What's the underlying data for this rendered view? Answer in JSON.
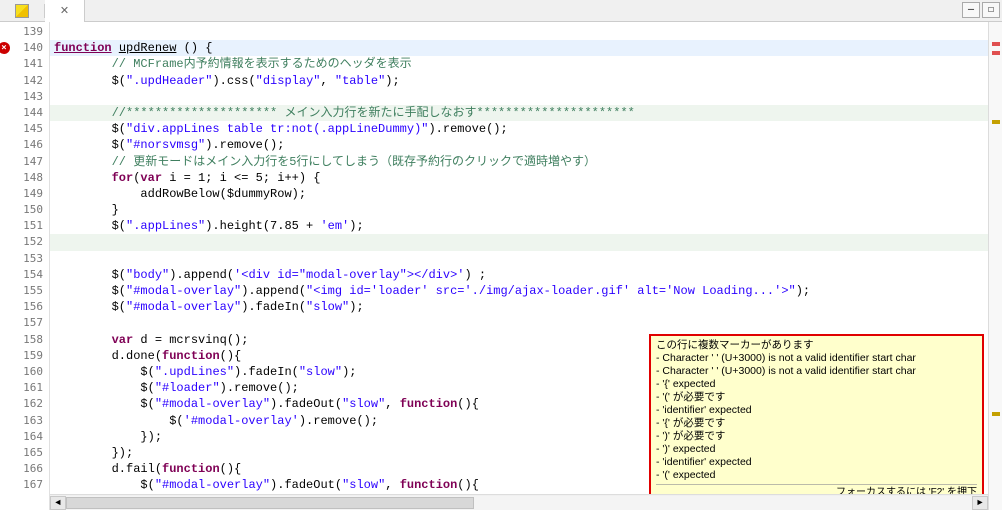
{
  "toolbar": {
    "close_glyph": "✕",
    "min_glyph": "—",
    "max_glyph": "☐"
  },
  "gutter": {
    "start": 139,
    "end": 167,
    "err_at": 140
  },
  "lines": [
    {
      "n": 139,
      "pre": "",
      "segs": []
    },
    {
      "n": 140,
      "pre": "",
      "hl": 1,
      "segs": [
        {
          "c": "kw under",
          "t": "function"
        },
        {
          "c": "",
          "t": " "
        },
        {
          "c": "id under",
          "t": "updRenew"
        },
        {
          "c": "",
          "t": " "
        },
        {
          "c": "op",
          "t": "() {"
        }
      ]
    },
    {
      "n": 141,
      "pre": "        ",
      "segs": [
        {
          "c": "cmj",
          "t": "// MCFrame内予約情報を表示するためのヘッダを表示"
        }
      ]
    },
    {
      "n": 142,
      "pre": "        ",
      "segs": [
        {
          "c": "id",
          "t": "$("
        },
        {
          "c": "str",
          "t": "\".updHeader\""
        },
        {
          "c": "id",
          "t": ").css("
        },
        {
          "c": "str",
          "t": "\"display\""
        },
        {
          "c": "id",
          "t": ", "
        },
        {
          "c": "str",
          "t": "\"table\""
        },
        {
          "c": "id",
          "t": ");"
        }
      ]
    },
    {
      "n": 143,
      "pre": "",
      "segs": []
    },
    {
      "n": 144,
      "pre": "        ",
      "hl": 2,
      "segs": [
        {
          "c": "cmj",
          "t": "//********************* メイン入力行を新たに手配しなおす**********************"
        }
      ]
    },
    {
      "n": 145,
      "pre": "        ",
      "segs": [
        {
          "c": "id",
          "t": "$("
        },
        {
          "c": "str",
          "t": "\"div.appLines table tr:not(.appLineDummy)\""
        },
        {
          "c": "id",
          "t": ").remove();"
        }
      ]
    },
    {
      "n": 146,
      "pre": "        ",
      "segs": [
        {
          "c": "id",
          "t": "$("
        },
        {
          "c": "str",
          "t": "\"#norsvmsg\""
        },
        {
          "c": "id",
          "t": ").remove();"
        }
      ]
    },
    {
      "n": 147,
      "pre": "        ",
      "segs": [
        {
          "c": "cmj",
          "t": "// 更新モードはメイン入力行を5行にしてしまう（既存予約行のクリックで適時増やす）"
        }
      ]
    },
    {
      "n": 148,
      "pre": "        ",
      "segs": [
        {
          "c": "kw",
          "t": "for"
        },
        {
          "c": "id",
          "t": "("
        },
        {
          "c": "kw",
          "t": "var"
        },
        {
          "c": "id",
          "t": " i = 1; i <= 5; i++) {"
        }
      ]
    },
    {
      "n": 149,
      "pre": "            ",
      "segs": [
        {
          "c": "id",
          "t": "addRowBelow($dummyRow);"
        }
      ]
    },
    {
      "n": 150,
      "pre": "        ",
      "segs": [
        {
          "c": "id",
          "t": "}"
        }
      ]
    },
    {
      "n": 151,
      "pre": "        ",
      "segs": [
        {
          "c": "id",
          "t": "$("
        },
        {
          "c": "str",
          "t": "\".appLines\""
        },
        {
          "c": "id",
          "t": ").height(7.85 + "
        },
        {
          "c": "str",
          "t": "'em'"
        },
        {
          "c": "id",
          "t": ");"
        }
      ]
    },
    {
      "n": 152,
      "pre": "",
      "hl": 2,
      "segs": []
    },
    {
      "n": 153,
      "pre": "",
      "segs": []
    },
    {
      "n": 154,
      "pre": "        ",
      "segs": [
        {
          "c": "id",
          "t": "$("
        },
        {
          "c": "str",
          "t": "\"body\""
        },
        {
          "c": "id",
          "t": ").append("
        },
        {
          "c": "str",
          "t": "'<div id=\"modal-overlay\"></div>'"
        },
        {
          "c": "id",
          "t": ") ;"
        }
      ]
    },
    {
      "n": 155,
      "pre": "        ",
      "segs": [
        {
          "c": "id",
          "t": "$("
        },
        {
          "c": "str",
          "t": "\"#modal-overlay\""
        },
        {
          "c": "id",
          "t": ").append("
        },
        {
          "c": "str",
          "t": "\"<img id='loader' src='./img/ajax-loader.gif' alt='Now Loading...'>\""
        },
        {
          "c": "id",
          "t": ");"
        }
      ]
    },
    {
      "n": 156,
      "pre": "        ",
      "segs": [
        {
          "c": "id",
          "t": "$("
        },
        {
          "c": "str",
          "t": "\"#modal-overlay\""
        },
        {
          "c": "id",
          "t": ").fadeIn("
        },
        {
          "c": "str",
          "t": "\"slow\""
        },
        {
          "c": "id",
          "t": ");"
        }
      ]
    },
    {
      "n": 157,
      "pre": "",
      "segs": []
    },
    {
      "n": 158,
      "pre": "        ",
      "segs": [
        {
          "c": "kw",
          "t": "var"
        },
        {
          "c": "id",
          "t": " d = mcrsvinq();"
        }
      ]
    },
    {
      "n": 159,
      "pre": "        ",
      "segs": [
        {
          "c": "id",
          "t": "d.done("
        },
        {
          "c": "kw",
          "t": "function"
        },
        {
          "c": "id",
          "t": "(){"
        }
      ]
    },
    {
      "n": 160,
      "pre": "            ",
      "segs": [
        {
          "c": "id",
          "t": "$("
        },
        {
          "c": "str",
          "t": "\".updLines\""
        },
        {
          "c": "id",
          "t": ").fadeIn("
        },
        {
          "c": "str",
          "t": "\"slow\""
        },
        {
          "c": "id",
          "t": ");"
        }
      ]
    },
    {
      "n": 161,
      "pre": "            ",
      "segs": [
        {
          "c": "id",
          "t": "$("
        },
        {
          "c": "str",
          "t": "\"#loader\""
        },
        {
          "c": "id",
          "t": ").remove();"
        }
      ]
    },
    {
      "n": 162,
      "pre": "            ",
      "segs": [
        {
          "c": "id",
          "t": "$("
        },
        {
          "c": "str",
          "t": "\"#modal-overlay\""
        },
        {
          "c": "id",
          "t": ").fadeOut("
        },
        {
          "c": "str",
          "t": "\"slow\""
        },
        {
          "c": "id",
          "t": ", "
        },
        {
          "c": "kw",
          "t": "function"
        },
        {
          "c": "id",
          "t": "(){"
        }
      ]
    },
    {
      "n": 163,
      "pre": "                ",
      "segs": [
        {
          "c": "id",
          "t": "$("
        },
        {
          "c": "str",
          "t": "'#modal-overlay'"
        },
        {
          "c": "id",
          "t": ").remove();"
        }
      ]
    },
    {
      "n": 164,
      "pre": "            ",
      "segs": [
        {
          "c": "id",
          "t": "});"
        }
      ]
    },
    {
      "n": 165,
      "pre": "        ",
      "segs": [
        {
          "c": "id",
          "t": "});"
        }
      ]
    },
    {
      "n": 166,
      "pre": "        ",
      "segs": [
        {
          "c": "id",
          "t": "d.fail("
        },
        {
          "c": "kw",
          "t": "function"
        },
        {
          "c": "id",
          "t": "(){"
        }
      ]
    },
    {
      "n": 167,
      "pre": "            ",
      "segs": [
        {
          "c": "id",
          "t": "$("
        },
        {
          "c": "str",
          "t": "\"#modal-overlay\""
        },
        {
          "c": "id",
          "t": ").fadeOut("
        },
        {
          "c": "str",
          "t": "\"slow\""
        },
        {
          "c": "id",
          "t": ", "
        },
        {
          "c": "kw",
          "t": "function"
        },
        {
          "c": "id",
          "t": "(){"
        }
      ]
    }
  ],
  "tooltip": {
    "title": "この行に複数マーカーがあります",
    "items": [
      "- Character ' ' (U+3000) is not a valid identifier start char",
      "- Character ' ' (U+3000) is not a valid identifier start char",
      "- '{' expected",
      "- '(' が必要です",
      "- 'identifier' expected",
      "- '{' が必要です",
      "- ')' が必要です",
      "- ')' expected",
      "- 'identifier' expected",
      "- '(' expected"
    ],
    "footer": "フォーカスするには 'F2' を押下"
  },
  "ov": [
    {
      "pct": 4,
      "c": "err"
    },
    {
      "pct": 6,
      "c": "err"
    },
    {
      "pct": 20,
      "c": "warn"
    },
    {
      "pct": 80,
      "c": "warn"
    }
  ]
}
